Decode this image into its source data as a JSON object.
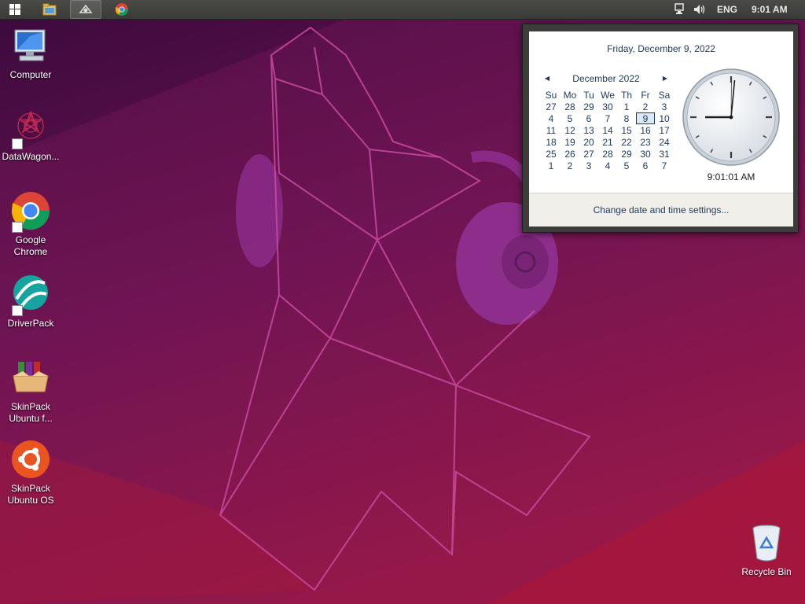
{
  "taskbar": {
    "language": "ENG",
    "time": "9:01 AM"
  },
  "desktop_icons": [
    {
      "label": "Computer",
      "icon": "computer-icon"
    },
    {
      "label": "DataWagon...",
      "icon": "datawagon-icon"
    },
    {
      "label": "Google Chrome",
      "icon": "chrome-icon"
    },
    {
      "label": "DriverPack",
      "icon": "driverpack-icon"
    },
    {
      "label": "SkinPack Ubuntu f...",
      "icon": "skinpack-box-icon"
    },
    {
      "label": "SkinPack Ubuntu OS",
      "icon": "ubuntu-icon"
    },
    {
      "label": "Recycle Bin",
      "icon": "recycle-bin-icon"
    }
  ],
  "calendar": {
    "date_header": "Friday, December 9, 2022",
    "month_title": "December 2022",
    "prev_glyph": "◀",
    "next_glyph": "▶",
    "weekdays": [
      "Su",
      "Mo",
      "Tu",
      "We",
      "Th",
      "Fr",
      "Sa"
    ],
    "weeks": [
      [
        "27",
        "28",
        "29",
        "30",
        "1",
        "2",
        "3"
      ],
      [
        "4",
        "5",
        "6",
        "7",
        "8",
        "9",
        "10"
      ],
      [
        "11",
        "12",
        "13",
        "14",
        "15",
        "16",
        "17"
      ],
      [
        "18",
        "19",
        "20",
        "21",
        "22",
        "23",
        "24"
      ],
      [
        "25",
        "26",
        "27",
        "28",
        "29",
        "30",
        "31"
      ],
      [
        "1",
        "2",
        "3",
        "4",
        "5",
        "6",
        "7"
      ]
    ],
    "selected_day": "9",
    "time": "9:01:01 AM",
    "settings_link": "Change date and time settings...",
    "colors": {
      "accent": "#1e395b",
      "footer": "#f1efe9"
    }
  }
}
